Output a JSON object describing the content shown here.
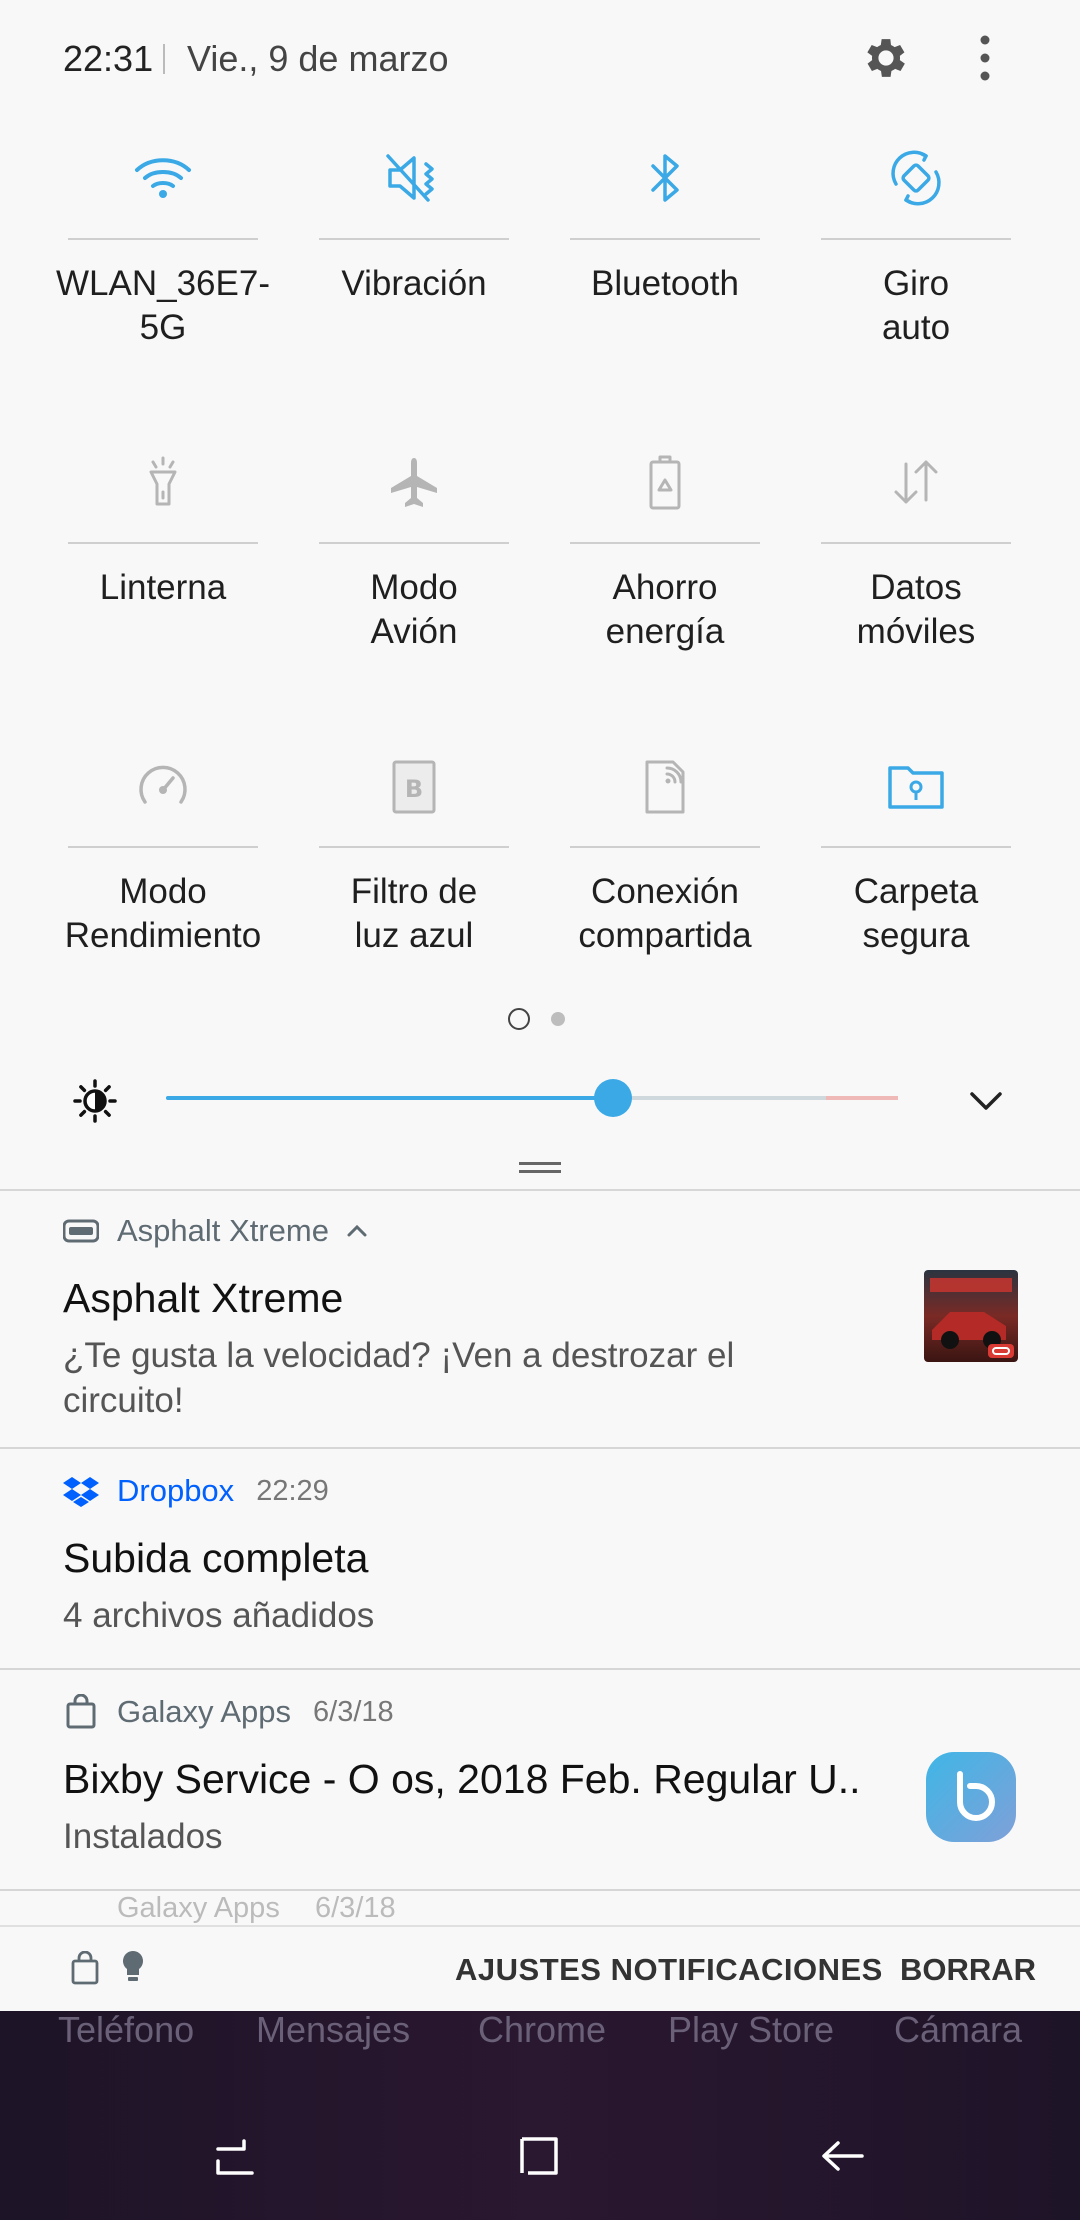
{
  "status_bar": {
    "time": "22:31",
    "date": "Vie., 9 de marzo"
  },
  "colors": {
    "accent_blue": "#3aa9e6",
    "inactive_icon": "#b5b5b5",
    "dropbox_blue": "#0061fe"
  },
  "quick_settings": [
    {
      "label": "WLAN_36E7-\n5G",
      "icon": "wifi-icon",
      "active": true
    },
    {
      "label": "Vibración",
      "icon": "vibrate-icon",
      "active": true
    },
    {
      "label": "Bluetooth",
      "icon": "bluetooth-icon",
      "active": true
    },
    {
      "label": "Giro\nauto",
      "icon": "auto-rotate-icon",
      "active": true
    },
    {
      "label": "Linterna",
      "icon": "flashlight-icon",
      "active": false
    },
    {
      "label": "Modo\nAvión",
      "icon": "airplane-icon",
      "active": false
    },
    {
      "label": "Ahorro\nenergía",
      "icon": "power-saving-icon",
      "active": false
    },
    {
      "label": "Datos\nmóviles",
      "icon": "mobile-data-icon",
      "active": false
    },
    {
      "label": "Modo\nRendimiento",
      "icon": "performance-icon",
      "active": false
    },
    {
      "label": "Filtro de\nluz azul",
      "icon": "blue-light-filter-icon",
      "active": false
    },
    {
      "label": "Conexión\ncompartida",
      "icon": "hotspot-icon",
      "active": false
    },
    {
      "label": "Carpeta\nsegura",
      "icon": "secure-folder-icon",
      "active": true
    }
  ],
  "pager": {
    "pages": 2,
    "current": 1
  },
  "brightness": {
    "level": 0.61
  },
  "notifications": [
    {
      "app": "Asphalt Xtreme",
      "time": "",
      "title": "Asphalt Xtreme",
      "body": "¿Te gusta la velocidad? ¡Ven a destrozar el circuito!",
      "icon": "gamepad-icon",
      "thumb": "asphalt-game-thumbnail"
    },
    {
      "app": "Dropbox",
      "time": "22:29",
      "title": "Subida completa",
      "body": "4 archivos añadidos",
      "icon": "dropbox-icon"
    },
    {
      "app": "Galaxy Apps",
      "time": "6/3/18",
      "title": "Bixby Service - O os, 2018 Feb. Regular U..",
      "body": "Instalados",
      "icon": "shopping-bag-icon",
      "thumb": "bixby-icon"
    }
  ],
  "peek_notification": {
    "app": "Galaxy Apps",
    "time": "6/3/18"
  },
  "bottom_bar": {
    "settings_label": "AJUSTES NOTIFICACIONES",
    "clear_label": "BORRAR"
  },
  "dock": [
    "Teléfono",
    "Mensajes",
    "Chrome",
    "Play Store",
    "Cámara"
  ],
  "nav_bar": [
    "recents-icon",
    "home-icon",
    "back-icon"
  ]
}
